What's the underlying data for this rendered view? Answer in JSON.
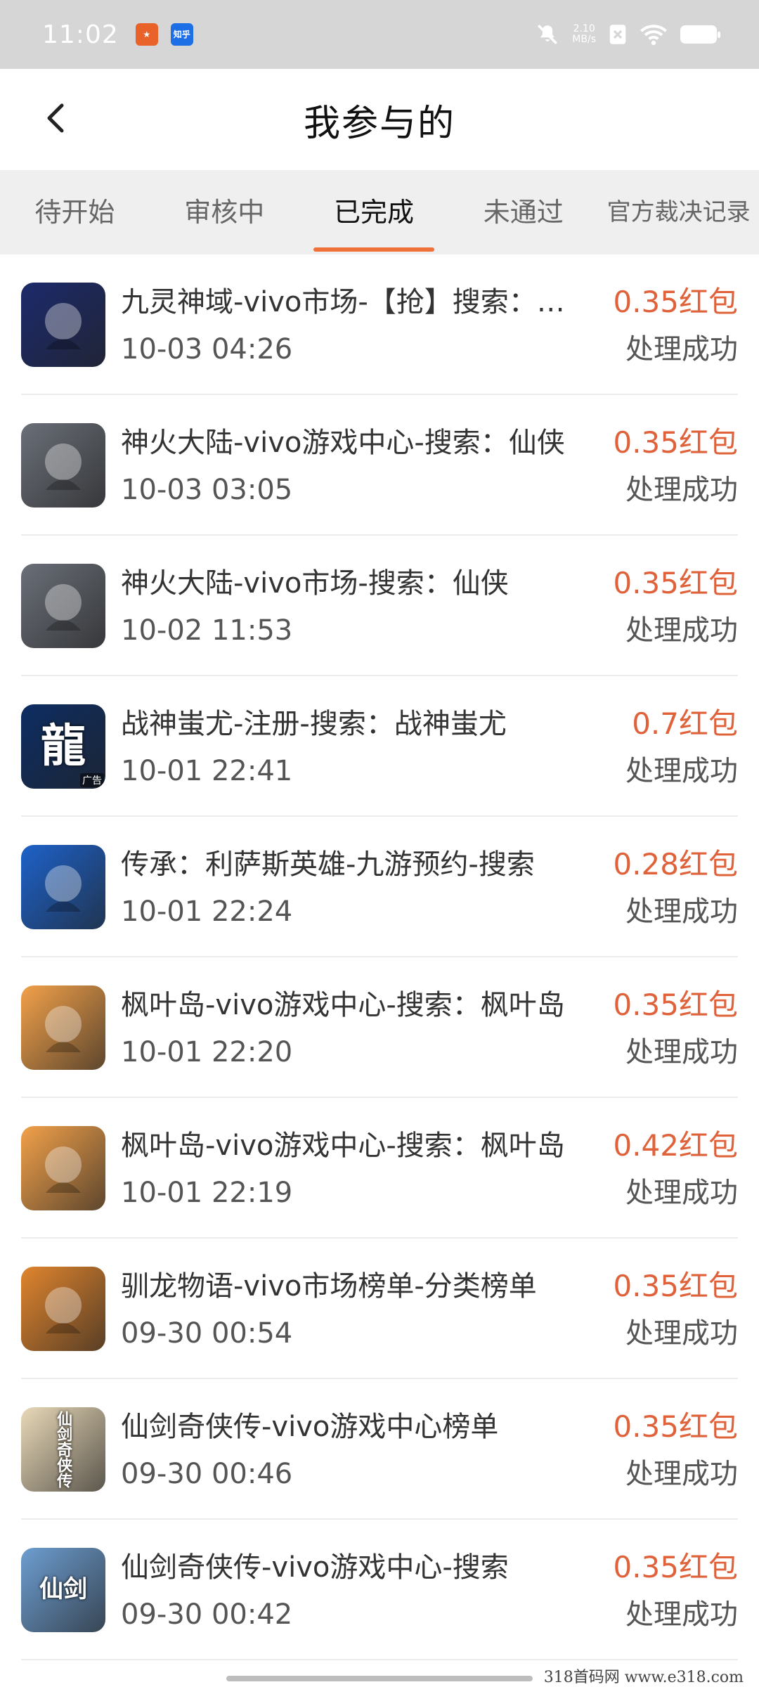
{
  "status_bar": {
    "time": "11:02",
    "net_speed_value": "2.10",
    "net_speed_unit": "MB/s",
    "app_icon_1": "news-app-icon",
    "app_icon_2": "zhihu-app-icon",
    "app_icon_2_label": "知乎"
  },
  "header": {
    "title": "我参与的"
  },
  "tabs": [
    {
      "label": "待开始",
      "active": false
    },
    {
      "label": "审核中",
      "active": false
    },
    {
      "label": "已完成",
      "active": true
    },
    {
      "label": "未通过",
      "active": false
    },
    {
      "label": "官方裁决记录",
      "active": false
    }
  ],
  "items": [
    {
      "name": "九灵神域-vivo市场-【抢】搜索：九灵神域",
      "date": "10-03 04:26",
      "reward": "0.35红包",
      "status": "处理成功",
      "icon": "blue-sword-game-icon",
      "icon_color": "#1c2a6b"
    },
    {
      "name": "神火大陆-vivo游戏中心-搜索：仙侠",
      "date": "10-03 03:05",
      "reward": "0.35红包",
      "status": "处理成功",
      "icon": "masked-warrior-game-icon",
      "icon_color": "#6a6f78"
    },
    {
      "name": "神火大陆-vivo市场-搜索：仙侠",
      "date": "10-02 11:53",
      "reward": "0.35红包",
      "status": "处理成功",
      "icon": "masked-warrior-game-icon",
      "icon_color": "#6a6f78"
    },
    {
      "name": "战神蚩尤-注册-搜索：战神蚩尤",
      "date": "10-01 22:41",
      "reward": "0.7红包",
      "status": "处理成功",
      "icon": "dragon-character-game-icon",
      "icon_color": "#0d2d63",
      "icon_char": "龍",
      "icon_badge": "广告"
    },
    {
      "name": "传承：利萨斯英雄-九游预约-搜索",
      "date": "10-01 22:24",
      "reward": "0.28红包",
      "status": "处理成功",
      "icon": "blue-crystal-game-icon",
      "icon_color": "#1d62c9"
    },
    {
      "name": "枫叶岛-vivo游戏中心-搜索：枫叶岛",
      "date": "10-01 22:20",
      "reward": "0.35红包",
      "status": "处理成功",
      "icon": "maple-girl-game-icon",
      "icon_color": "#f2a14a"
    },
    {
      "name": "枫叶岛-vivo游戏中心-搜索：枫叶岛",
      "date": "10-01 22:19",
      "reward": "0.42红包",
      "status": "处理成功",
      "icon": "maple-girl-game-icon",
      "icon_color": "#f2a14a"
    },
    {
      "name": "驯龙物语-vivo市场榜单-分类榜单",
      "date": "09-30 00:54",
      "reward": "0.35红包",
      "status": "处理成功",
      "icon": "panda-game-icon",
      "icon_color": "#e0852e"
    },
    {
      "name": "仙剑奇侠传-vivo游戏中心榜单",
      "date": "09-30 00:46",
      "reward": "0.35红包",
      "status": "处理成功",
      "icon": "swordsman-game-icon",
      "icon_color": "#e9d9b8",
      "icon_char": "仙剑奇侠传"
    },
    {
      "name": "仙剑奇侠传-vivo游戏中心-搜索",
      "date": "09-30 00:42",
      "reward": "0.35红包",
      "status": "处理成功",
      "icon": "ice-sword-game-icon",
      "icon_color": "#6d9ed1",
      "icon_char": "仙剑"
    }
  ],
  "watermark": "318首码网  www.e318.com",
  "colors": {
    "accent": "#f0703a",
    "reward": "#e0623a",
    "statusbar": "#d6d6d6",
    "tabs_bg": "#efefef"
  }
}
